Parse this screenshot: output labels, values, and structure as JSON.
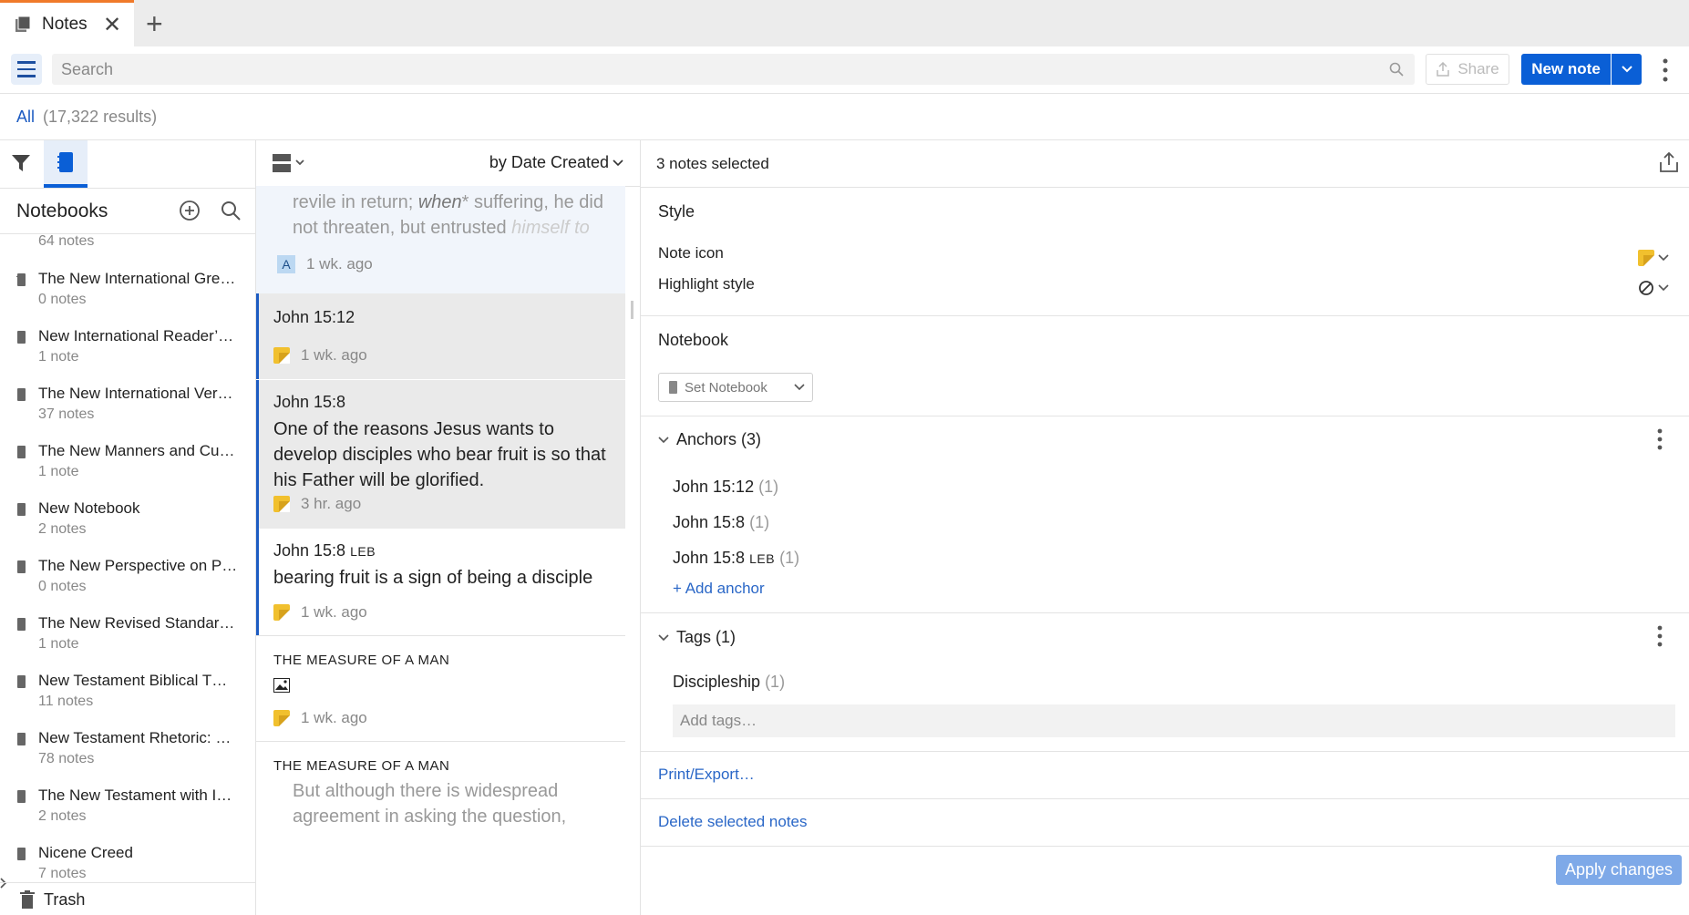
{
  "tab": {
    "title": "Notes",
    "close_glyph": "✕",
    "add_glyph": "+"
  },
  "toolbar": {
    "search_placeholder": "Search",
    "share_label": "Share",
    "new_note_label": "New note"
  },
  "results": {
    "all_label": "All",
    "count_label": "(17,322 results)"
  },
  "sidebar": {
    "header": "Notebooks",
    "top_count": "64 notes",
    "items": [
      {
        "name": "The New International Gre…",
        "count": "0 notes"
      },
      {
        "name": "New International Reader’…",
        "count": "1 note"
      },
      {
        "name": "The New International Ver…",
        "count": "37 notes"
      },
      {
        "name": "The New Manners and Cus…",
        "count": "1 note"
      },
      {
        "name": "New Notebook",
        "count": "2 notes"
      },
      {
        "name": "The New Perspective on P…",
        "count": "0 notes"
      },
      {
        "name": "The New Revised Standar…",
        "count": "1 note"
      },
      {
        "name": "New Testament Biblical T…",
        "count": "11 notes"
      },
      {
        "name": "New Testament Rhetoric: …",
        "count": "78 notes"
      },
      {
        "name": "The New Testament with I…",
        "count": "2 notes"
      },
      {
        "name": "Nicene Creed",
        "count": "7 notes"
      }
    ],
    "trash_label": "Trash"
  },
  "list": {
    "sort_label": "by Date Created",
    "notes": [
      {
        "body_line1_a": "revile in return; ",
        "body_line1_em": "when",
        "body_line1_b": "* suffering, he did",
        "body_line2_a": "not threaten, but entrusted ",
        "body_line2_em": "himself to",
        "badge": "A",
        "time": "1 wk. ago"
      },
      {
        "title": "John 15:12",
        "time": "1 wk. ago"
      },
      {
        "title": "John 15:8",
        "body": "One of the reasons Jesus wants to develop disciples who bear fruit is so that his Father will be glorified.",
        "time": "3 hr. ago"
      },
      {
        "title": "John 15:8",
        "title_suffix": "LEB",
        "body": "bearing fruit is a sign of being a disciple",
        "time": "1 wk. ago"
      },
      {
        "title": "THE MEASURE OF A MAN",
        "time": "1 wk. ago"
      },
      {
        "title": "THE MEASURE OF A MAN",
        "body": "But although there is widespread agreement in asking the question,"
      }
    ]
  },
  "detail": {
    "selected_label": "3 notes selected",
    "style_header": "Style",
    "note_icon_label": "Note icon",
    "highlight_style_label": "Highlight style",
    "notebook_header": "Notebook",
    "set_notebook_label": "Set Notebook",
    "anchors_header": "Anchors (3)",
    "anchors": [
      {
        "ref": "John 15:12",
        "suffix": "",
        "count": "(1)"
      },
      {
        "ref": "John 15:8",
        "suffix": "",
        "count": "(1)"
      },
      {
        "ref": "John 15:8",
        "suffix": "LEB",
        "count": "(1)"
      }
    ],
    "add_anchor_label": "+ Add anchor",
    "tags_header": "Tags (1)",
    "tags": [
      {
        "name": "Discipleship",
        "count": "(1)"
      }
    ],
    "add_tags_placeholder": "Add tags…",
    "print_export_label": "Print/Export…",
    "delete_label": "Delete selected notes",
    "apply_label": "Apply changes"
  },
  "colors": {
    "accent": "#0a5fd6",
    "link": "#2a67c7",
    "sticky": "#f1c02e",
    "tab_indicator": "#f07a2a"
  }
}
